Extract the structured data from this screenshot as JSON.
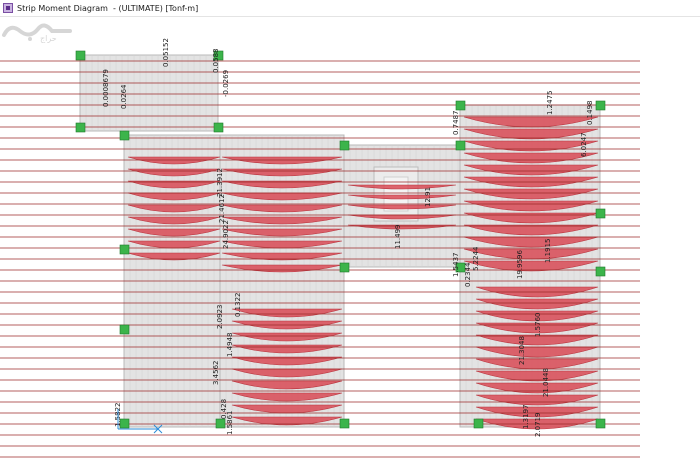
{
  "window": {
    "title": "Strip Moment Diagram  - (ULTIMATE) [Tonf-m]",
    "icon": "strip-diagram-app-icon"
  },
  "colors": {
    "gridline": "#9c2a2a",
    "slab_fill": "#e3e3e3",
    "slab_edge": "#b8b8b8",
    "moment": "#d84a55",
    "support": "#3cb44b",
    "opening": "#f4f4f4",
    "watermark": "#d6d6d6"
  },
  "moment_labels": [
    "0.05152",
    "0.0588",
    "0.0264",
    "0.0008679",
    "-0.0269",
    "0.7487",
    "1.2475",
    "0.1498",
    "6.0247",
    "21.3912",
    "21.4612",
    "24.9022",
    "1.5437",
    "0.2344",
    "11.499",
    "12.91",
    "1.1915",
    "5.2244",
    "19.9596",
    "1.5760",
    "21.3048",
    "21.0448",
    "1.3197",
    "0.428",
    "2.0923",
    "1.4948",
    "3.4562",
    "1.5861",
    "1.5822",
    "0.1322",
    "2.0719"
  ],
  "watermark": {
    "icon": "haraj-watermark-icon",
    "text": "حراج"
  }
}
